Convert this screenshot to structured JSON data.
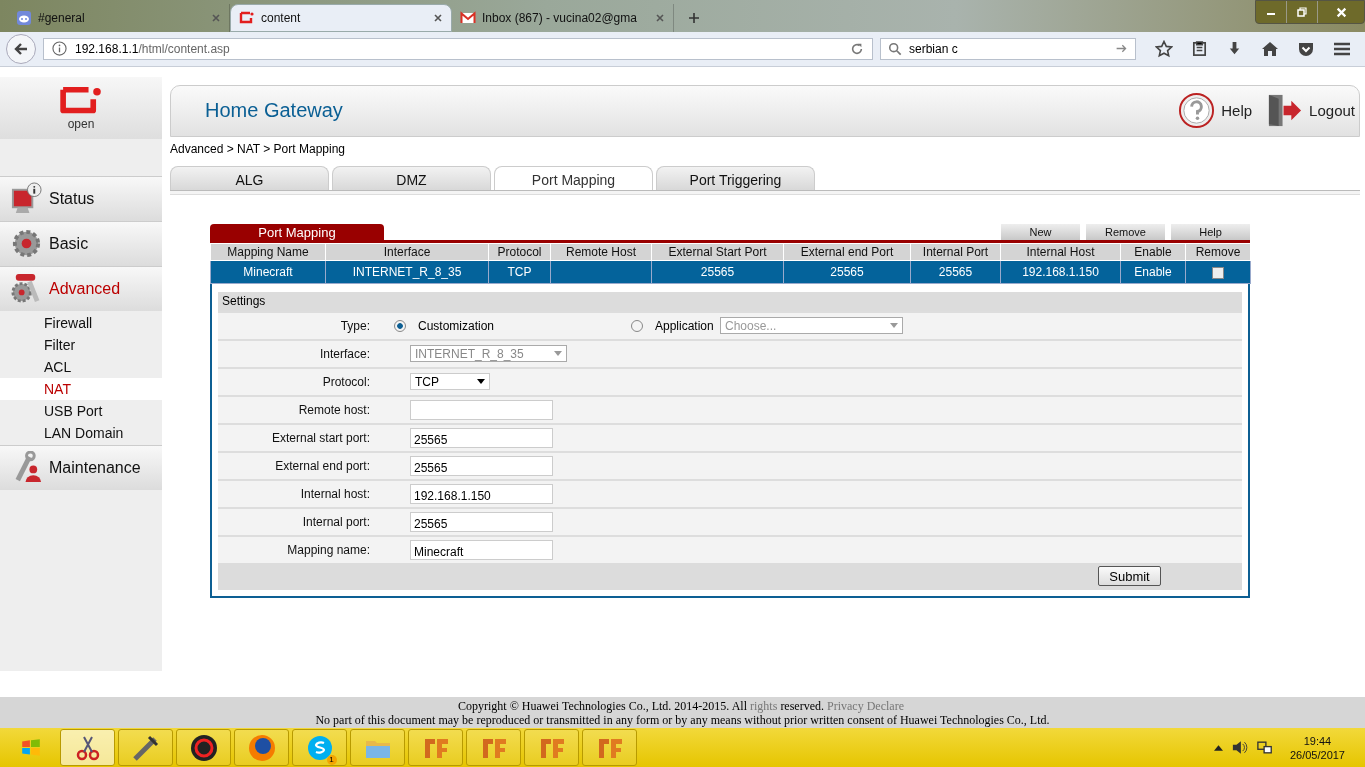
{
  "browser": {
    "tabs": [
      {
        "title": "#general",
        "selected": false,
        "kind": "gamepad"
      },
      {
        "title": "content",
        "selected": true,
        "kind": "router"
      },
      {
        "title": "Inbox (867) - vucina02@gma",
        "selected": false,
        "kind": "mail"
      }
    ],
    "url": {
      "host": "192.168.1.1",
      "path": "/html/content.asp"
    },
    "search": {
      "value": "serbian c"
    }
  },
  "header": {
    "logo": "open",
    "title": "Home Gateway",
    "help": "Help",
    "logout": "Logout"
  },
  "breadcrumb": "Advanced > NAT > Port Mapping",
  "sidebar": {
    "items": [
      {
        "label": "Status",
        "kind": "monitor",
        "selected": false
      },
      {
        "label": "Basic",
        "kind": "gear",
        "selected": false
      },
      {
        "label": "Advanced",
        "kind": "gears",
        "selected": true,
        "children": [
          {
            "label": "Firewall",
            "selected": false
          },
          {
            "label": "Filter",
            "selected": false
          },
          {
            "label": "ACL",
            "selected": false
          },
          {
            "label": "NAT",
            "selected": true
          },
          {
            "label": "USB Port",
            "selected": false
          },
          {
            "label": "LAN Domain",
            "selected": false
          }
        ]
      },
      {
        "label": "Maintenance",
        "kind": "wrench",
        "selected": false
      }
    ]
  },
  "tabs": [
    {
      "label": "ALG",
      "selected": false
    },
    {
      "label": "DMZ",
      "selected": false
    },
    {
      "label": "Port Mapping",
      "selected": true
    },
    {
      "label": "Port Triggering",
      "selected": false
    }
  ],
  "panel": {
    "title": "Port Mapping",
    "buttons": [
      "New",
      "Remove",
      "Help"
    ],
    "table": {
      "columns": [
        "Mapping Name",
        "Interface",
        "Protocol",
        "Remote Host",
        "External Start Port",
        "External end Port",
        "Internal Port",
        "Internal Host",
        "Enable",
        "Remove"
      ],
      "rows": [
        {
          "selected": true,
          "cells": [
            "Minecraft",
            "INTERNET_R_8_35",
            "TCP",
            null,
            "25565",
            "25565",
            "25565",
            "192.168.1.150",
            "Enable"
          ],
          "remove_checked": false
        }
      ]
    },
    "settings": {
      "title": "Settings",
      "type_label": "Type:",
      "type_options": [
        {
          "label": "Customization",
          "selected": true
        },
        {
          "label": "Application",
          "selected": false
        }
      ],
      "application_placeholder": "Choose...",
      "fields": [
        {
          "label": "Interface:",
          "kind": "select",
          "value": "INTERNET_R_8_35",
          "disabled": true
        },
        {
          "label": "Protocol:",
          "kind": "select",
          "value": "TCP",
          "disabled": false
        },
        {
          "label": "Remote host:",
          "kind": "input"
        },
        {
          "label": "External start port:",
          "kind": "input",
          "value": "25565"
        },
        {
          "label": "External end port:",
          "kind": "input",
          "value": "25565"
        },
        {
          "label": "Internal host:",
          "kind": "input",
          "value": "192.168.1.150"
        },
        {
          "label": "Internal port:",
          "kind": "input",
          "value": "25565"
        },
        {
          "label": "Mapping name:",
          "kind": "input",
          "value": "Minecraft"
        }
      ],
      "submit": "Submit"
    }
  },
  "footer": {
    "line1": [
      {
        "kind": "text",
        "text": "Copyright © Huawei Technologies Co., Ltd. 2014-2015. All"
      },
      {
        "kind": "link",
        "text": "rights"
      },
      {
        "kind": "text",
        "text": "reserved."
      },
      {
        "kind": "link",
        "text": "Privacy Declare"
      }
    ],
    "line2": "No part of this document may be reproduced or transmitted in any form or by any means without prior written consent of Huawei Technologies Co., Ltd."
  },
  "taskbar": {
    "apps": [
      {
        "kind": "scissors",
        "selected": true
      },
      {
        "kind": "tool",
        "selected": false
      },
      {
        "kind": "shield",
        "selected": false
      },
      {
        "kind": "globe",
        "selected": false
      },
      {
        "kind": "chat",
        "selected": false,
        "badge": "1"
      },
      {
        "kind": "folder",
        "selected": false
      },
      {
        "kind": "tile",
        "selected": false
      },
      {
        "kind": "tile",
        "selected": false
      },
      {
        "kind": "tile",
        "selected": false
      },
      {
        "kind": "tile",
        "selected": false
      }
    ],
    "time": "19:44",
    "date": "26/05/2017"
  }
}
